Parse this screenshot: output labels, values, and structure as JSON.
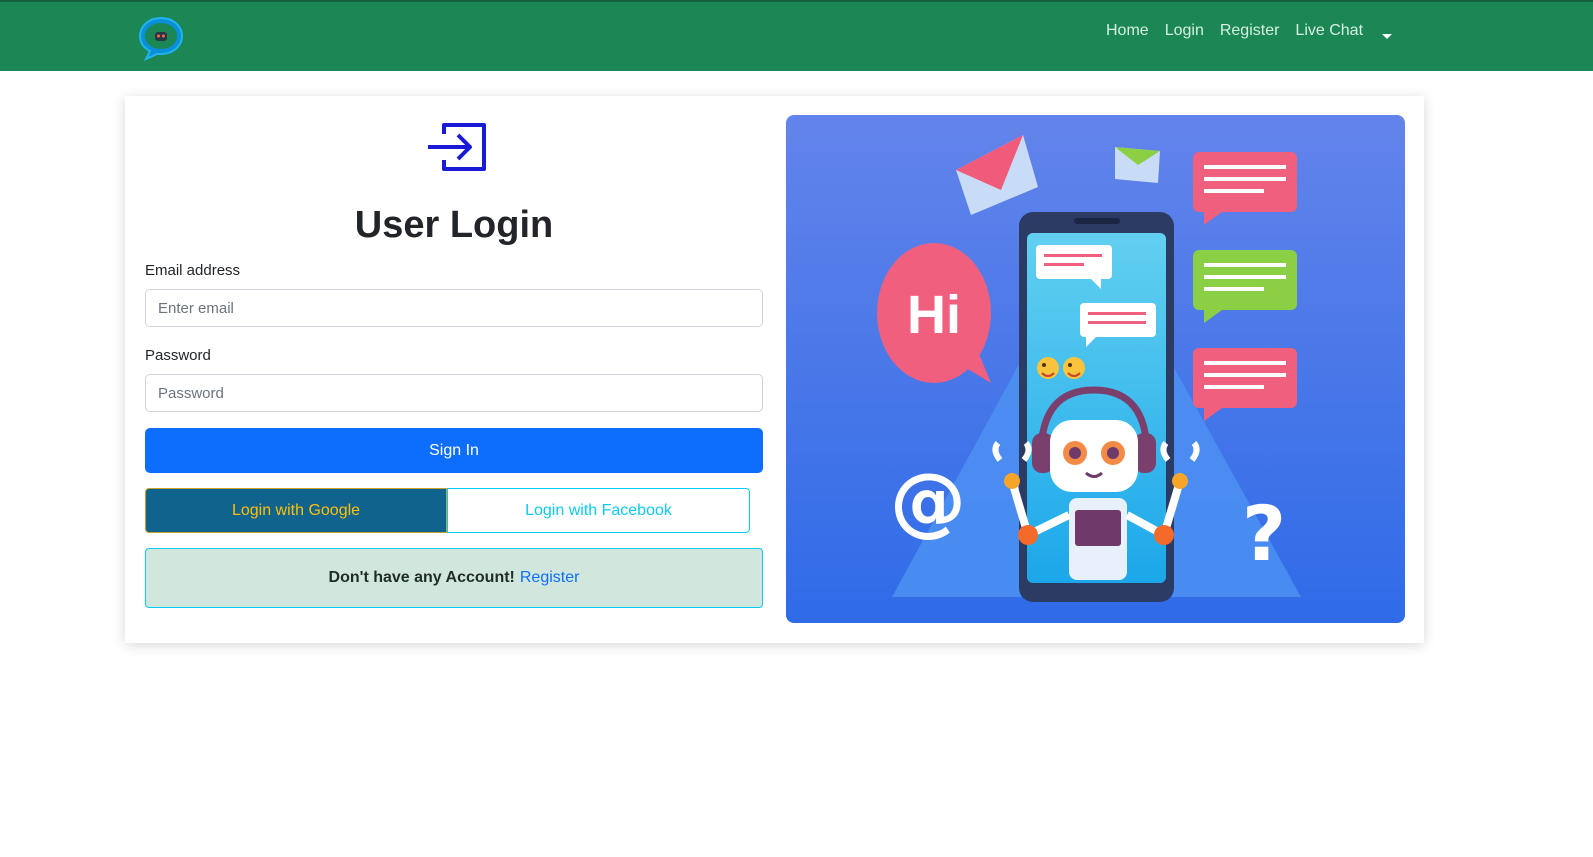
{
  "navbar": {
    "brand_icon": "chat-bubble-logo",
    "links": [
      "Home",
      "Login",
      "Register",
      "Live Chat"
    ],
    "dropdown_icon": "caret-down-icon"
  },
  "login": {
    "icon": "login-arrow-icon",
    "title": "User Login",
    "email_label": "Email address",
    "email_placeholder": "Enter email",
    "password_label": "Password",
    "password_placeholder": "Password",
    "signin_label": "Sign In",
    "google_label": "Login with Google",
    "facebook_label": "Login with Facebook",
    "account_prompt": "Don't have any Account!",
    "register_link": "Register"
  },
  "illustration": {
    "bubble_hi_text": "Hi",
    "at_symbol": "@",
    "question_symbol": "?"
  },
  "colors": {
    "navbar": "#1a8754",
    "primary": "#0d6efd",
    "google_bg": "#10638c",
    "google_text": "#ffc107",
    "facebook": "#0dcaf0",
    "alert_bg": "#d1e7dd",
    "login_icon": "#1a1ad6"
  }
}
